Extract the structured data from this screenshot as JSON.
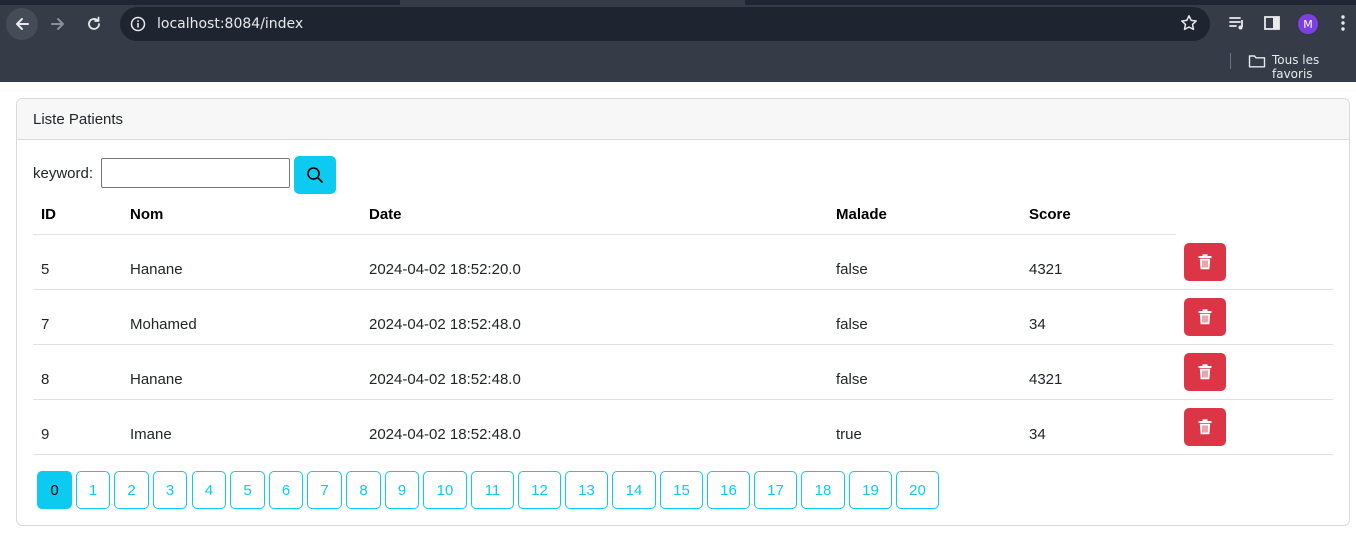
{
  "browser": {
    "url": "localhost:8084/index",
    "profile_initial": "M",
    "bookmarks_label": "Tous les favoris"
  },
  "card": {
    "title": "Liste Patients"
  },
  "search": {
    "label": "keyword:",
    "value": "",
    "button_icon": "search-icon"
  },
  "table": {
    "headers": [
      "ID",
      "Nom",
      "Date",
      "Malade",
      "Score"
    ],
    "rows": [
      {
        "id": "5",
        "nom": "Hanane",
        "date": "2024-04-02 18:52:20.0",
        "malade": "false",
        "score": "4321"
      },
      {
        "id": "7",
        "nom": "Mohamed",
        "date": "2024-04-02 18:52:48.0",
        "malade": "false",
        "score": "34"
      },
      {
        "id": "8",
        "nom": "Hanane",
        "date": "2024-04-02 18:52:48.0",
        "malade": "false",
        "score": "4321"
      },
      {
        "id": "9",
        "nom": "Imane",
        "date": "2024-04-02 18:52:48.0",
        "malade": "true",
        "score": "34"
      }
    ],
    "delete_icon": "trash-icon"
  },
  "pagination": {
    "pages": [
      "0",
      "1",
      "2",
      "3",
      "4",
      "5",
      "6",
      "7",
      "8",
      "9",
      "10",
      "11",
      "12",
      "13",
      "14",
      "15",
      "16",
      "17",
      "18",
      "19",
      "20"
    ],
    "active": "0"
  },
  "colors": {
    "info": "#0dcaf0",
    "danger": "#dc3545",
    "chrome_bg": "#353c48",
    "omnibox_bg": "#1e2430"
  }
}
